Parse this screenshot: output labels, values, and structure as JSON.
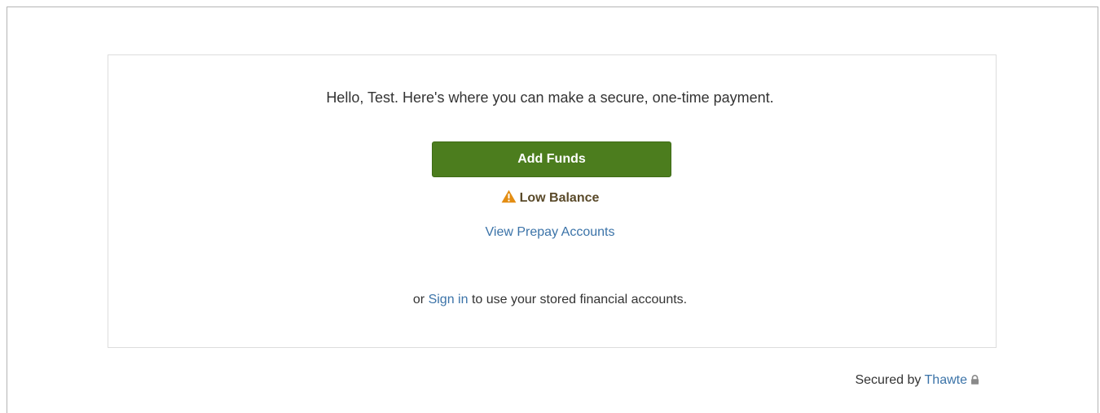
{
  "greeting": "Hello, Test. Here's where you can make a secure, one-time payment.",
  "add_funds_label": "Add Funds",
  "balance_status": {
    "label": "Low Balance",
    "icon": "warning-icon",
    "icon_color": "#e38d13"
  },
  "view_prepay_label": "View Prepay Accounts",
  "signin": {
    "prefix": "or",
    "link": "Sign in",
    "suffix": "to use your stored financial accounts."
  },
  "security": {
    "prefix": "Secured by",
    "provider": "Thawte",
    "icon": "lock-icon"
  },
  "colors": {
    "button": "#4c7d1e",
    "link": "#3b73a8"
  }
}
